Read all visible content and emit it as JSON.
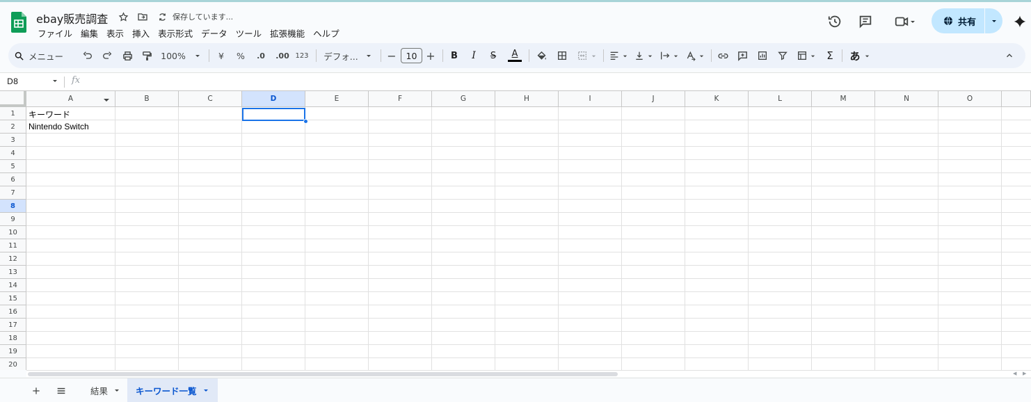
{
  "app": {
    "title": "ebay販売調査",
    "saving_status": "保存しています...",
    "share_label": "共有"
  },
  "menu": [
    "ファイル",
    "編集",
    "表示",
    "挿入",
    "表示形式",
    "データ",
    "ツール",
    "拡張機能",
    "ヘルプ"
  ],
  "toolbar": {
    "search_label": "メニュー",
    "zoom": "100%",
    "currency": "¥",
    "percent": "%",
    "dec_decrease": ".0",
    "dec_increase": ".00",
    "number_format": "123",
    "font_name": "デフォ...",
    "font_size": "10",
    "bold": "B",
    "italic": "I",
    "strike": "S",
    "text_color": "A",
    "input_tools": "あ",
    "sum": "Σ",
    "minus": "−",
    "plus": "+"
  },
  "formula_bar": {
    "name_box": "D8",
    "fx": "fx"
  },
  "grid": {
    "columns": [
      "A",
      "B",
      "C",
      "D",
      "E",
      "F",
      "G",
      "H",
      "I",
      "J",
      "K",
      "L",
      "M",
      "N",
      "O"
    ],
    "rows": [
      "1",
      "2",
      "3",
      "4",
      "5",
      "6",
      "7",
      "8",
      "9",
      "10",
      "11",
      "12",
      "13",
      "14",
      "15",
      "16",
      "17",
      "18",
      "19",
      "20"
    ],
    "selected_column": "D",
    "selected_row": "8",
    "cells": {
      "A1": "キーワード",
      "A2": "Nintendo Switch"
    }
  },
  "sheets": {
    "tabs": [
      {
        "label": "結果",
        "active": false
      },
      {
        "label": "キーワード一覧",
        "active": true
      }
    ]
  },
  "colors": {
    "accent": "#1a73e8",
    "share_bg": "#c2e7ff",
    "toolbar_bg": "#edf2fa",
    "logo_green": "#0f9d58"
  }
}
